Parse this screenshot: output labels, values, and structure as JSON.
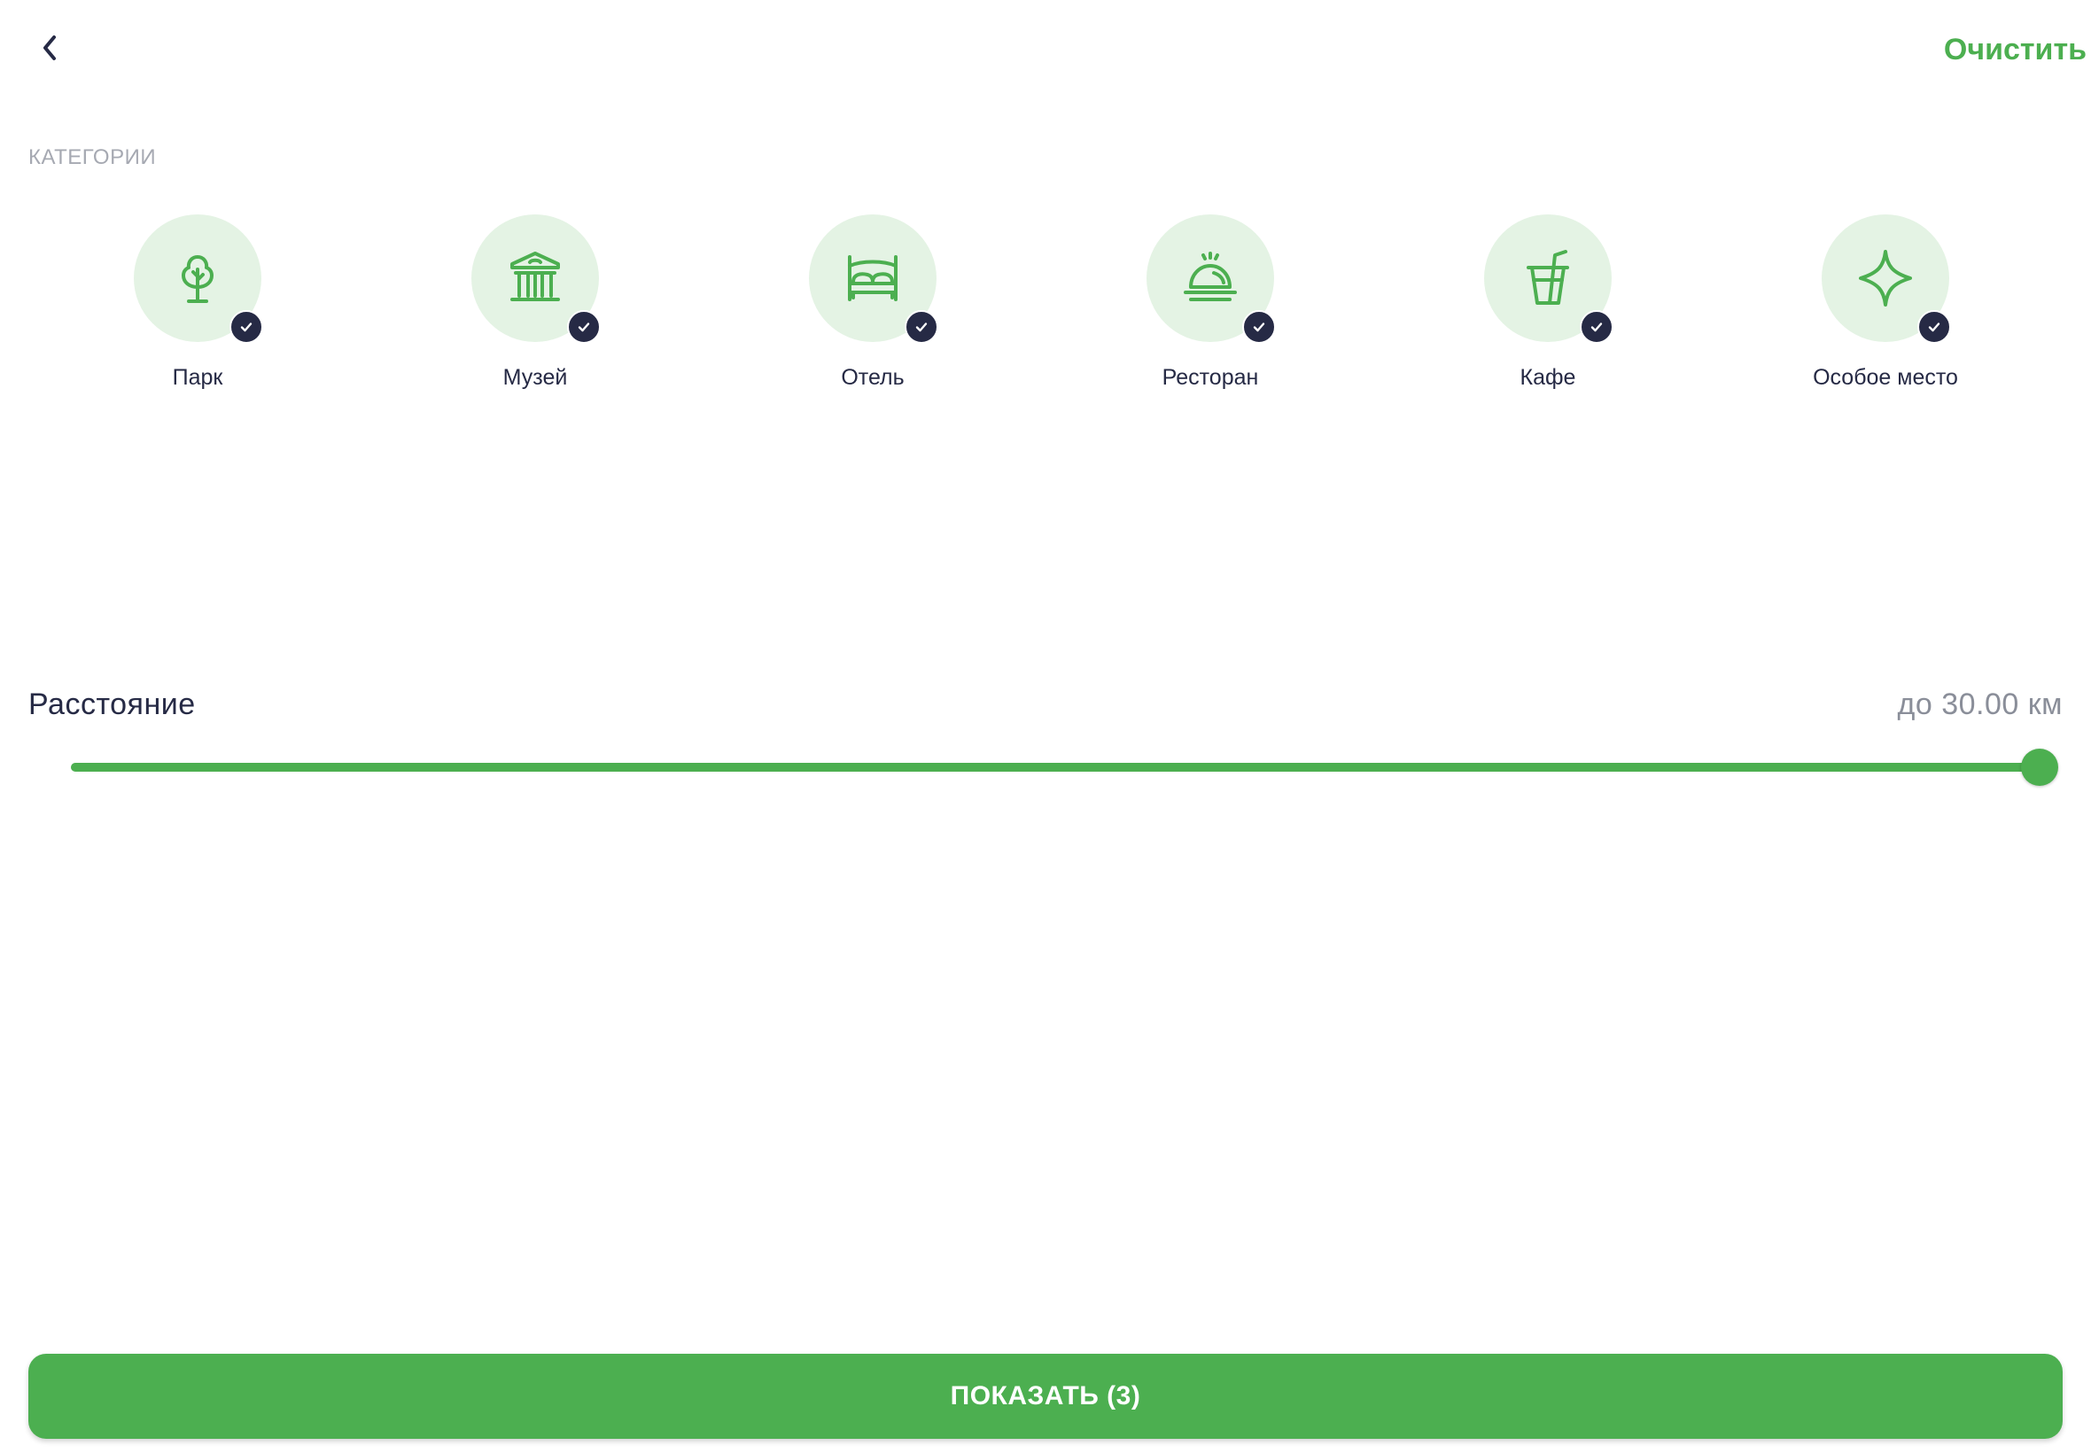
{
  "header": {
    "back_icon": "chevron-left-icon",
    "clear_label": "Очистить"
  },
  "categories": {
    "section_label": "КАТЕГОРИИ",
    "items": [
      {
        "label": "Парк",
        "icon": "tree-icon",
        "selected": true
      },
      {
        "label": "Музей",
        "icon": "museum-icon",
        "selected": true
      },
      {
        "label": "Отель",
        "icon": "bed-icon",
        "selected": true
      },
      {
        "label": "Ресторан",
        "icon": "cloche-icon",
        "selected": true
      },
      {
        "label": "Кафе",
        "icon": "drink-cup-icon",
        "selected": true
      },
      {
        "label": "Особое место",
        "icon": "sparkle-icon",
        "selected": true
      }
    ]
  },
  "distance": {
    "title": "Расстояние",
    "value_label": "до 30.00 км",
    "slider_fraction": 1.0
  },
  "footer": {
    "show_label": "ПОКАЗАТЬ (3)"
  },
  "colors": {
    "accent": "#4caf50",
    "accent_light": "#e4f3e4",
    "dark": "#262a45",
    "muted": "#a6a9b2"
  }
}
